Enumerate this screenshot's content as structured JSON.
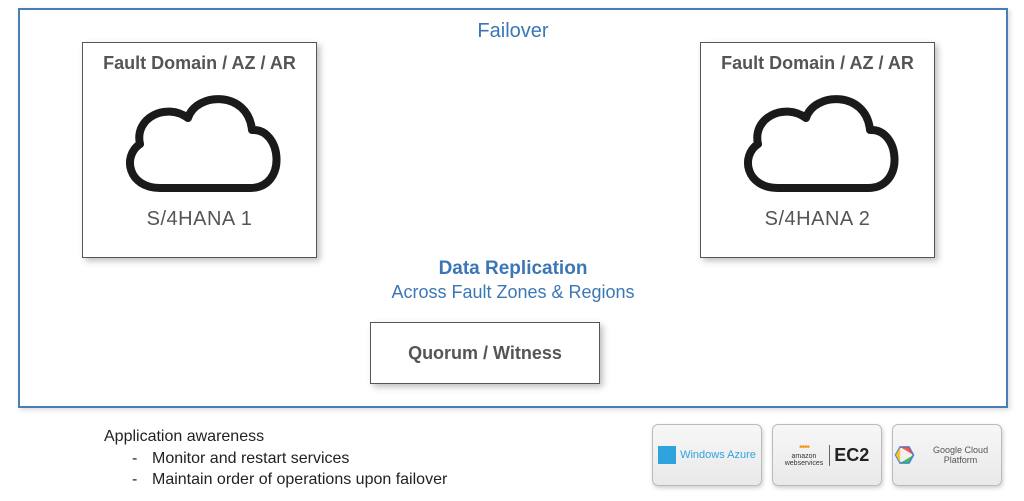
{
  "diagram": {
    "failover_title": "Failover",
    "domain_left": {
      "title": "Fault Domain / AZ / AR",
      "subtitle": "S/4HANA 1"
    },
    "domain_right": {
      "title": "Fault Domain / AZ / AR",
      "subtitle": "S/4HANA 2"
    },
    "data_replication": {
      "title": "Data Replication",
      "subtitle": "Across Fault Zones & Regions"
    },
    "quorum_label": "Quorum / Witness"
  },
  "footer": {
    "heading": "Application awareness",
    "bullets": [
      "Monitor and restart services",
      "Maintain order of operations upon failover"
    ]
  },
  "providers": {
    "azure": "Windows Azure",
    "aws_top": "amazon",
    "aws_bottom": "webservices",
    "aws_right": "EC2",
    "gcp": "Google Cloud Platform"
  }
}
